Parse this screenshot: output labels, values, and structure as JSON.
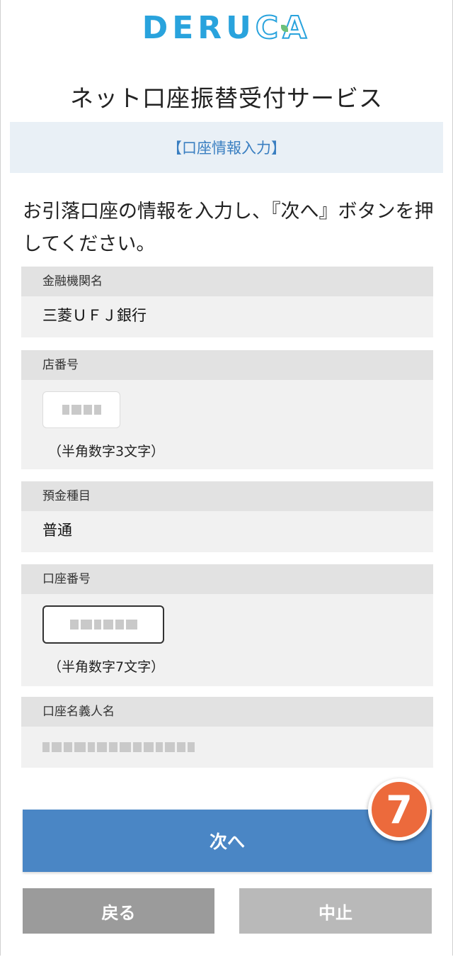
{
  "logo": {
    "part1": "DERU",
    "part2": "CA"
  },
  "service_title": "ネット口座振替受付サービス",
  "step_label": "【口座情報入力】",
  "instruction": "お引落口座の情報を入力し、『次へ』ボタンを押してください。",
  "fields": {
    "bank": {
      "label": "金融機関名",
      "value": "三菱ＵＦＪ銀行"
    },
    "branch": {
      "label": "店番号",
      "note": "（半角数字3文字）"
    },
    "deposit_type": {
      "label": "預金種目",
      "value": "普通"
    },
    "account_number": {
      "label": "口座番号",
      "note": "（半角数字7文字）"
    },
    "account_holder": {
      "label": "口座名義人名"
    }
  },
  "buttons": {
    "next": "次へ",
    "back": "戻る",
    "stop": "中止"
  },
  "badge": "7",
  "colors": {
    "brand": "#29a3dd",
    "step_text": "#3a7fc1",
    "next_button": "#4a86c5",
    "badge": "#ec6a3c",
    "back_button": "#9b9b9b",
    "stop_button": "#b9b9b9"
  }
}
